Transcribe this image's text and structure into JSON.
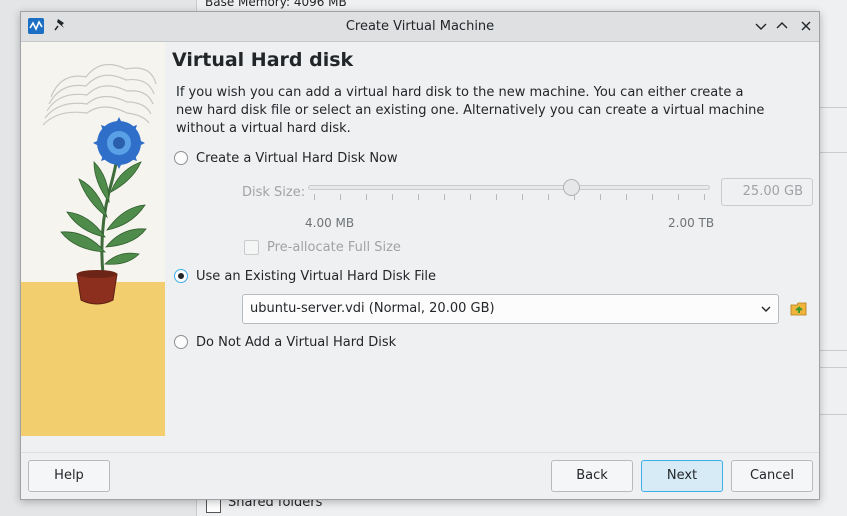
{
  "background": {
    "top_text": "Base Memory:   4096 MB",
    "bottom_text": "Shared folders"
  },
  "titlebar": {
    "title": "Create Virtual Machine",
    "icons": [
      "virtualbox-app-icon",
      "pin-icon",
      "chevron-down-icon",
      "chevron-up-icon",
      "close-icon"
    ]
  },
  "page": {
    "heading": "Virtual Hard disk",
    "description": "If you wish you can add a virtual hard disk to the new machine. You can either create a new hard disk file or select an existing one. Alternatively you can create a virtual machine without a virtual hard disk."
  },
  "options": {
    "create_now": {
      "label": "Create a Virtual Hard Disk Now",
      "checked": false
    },
    "use_existing": {
      "label": "Use an Existing Virtual Hard Disk File",
      "checked": true
    },
    "no_disk": {
      "label": "Do Not Add a Virtual Hard Disk",
      "checked": false
    }
  },
  "disk_size": {
    "label": "Disk Size:",
    "value": "25.00 GB",
    "min_label": "4.00 MB",
    "max_label": "2.00 TB",
    "enabled": false
  },
  "preallocate": {
    "label": "Pre-allocate Full Size",
    "checked": false,
    "enabled": false
  },
  "existing_disk": {
    "selected": "ubuntu-server.vdi (Normal, 20.00 GB)"
  },
  "buttons": {
    "help": "Help",
    "back": "Back",
    "next": "Next",
    "cancel": "Cancel"
  },
  "colors": {
    "accent": "#3daee9",
    "window_bg": "#eff0f1",
    "illustration_ground": "#f2ce6f"
  }
}
